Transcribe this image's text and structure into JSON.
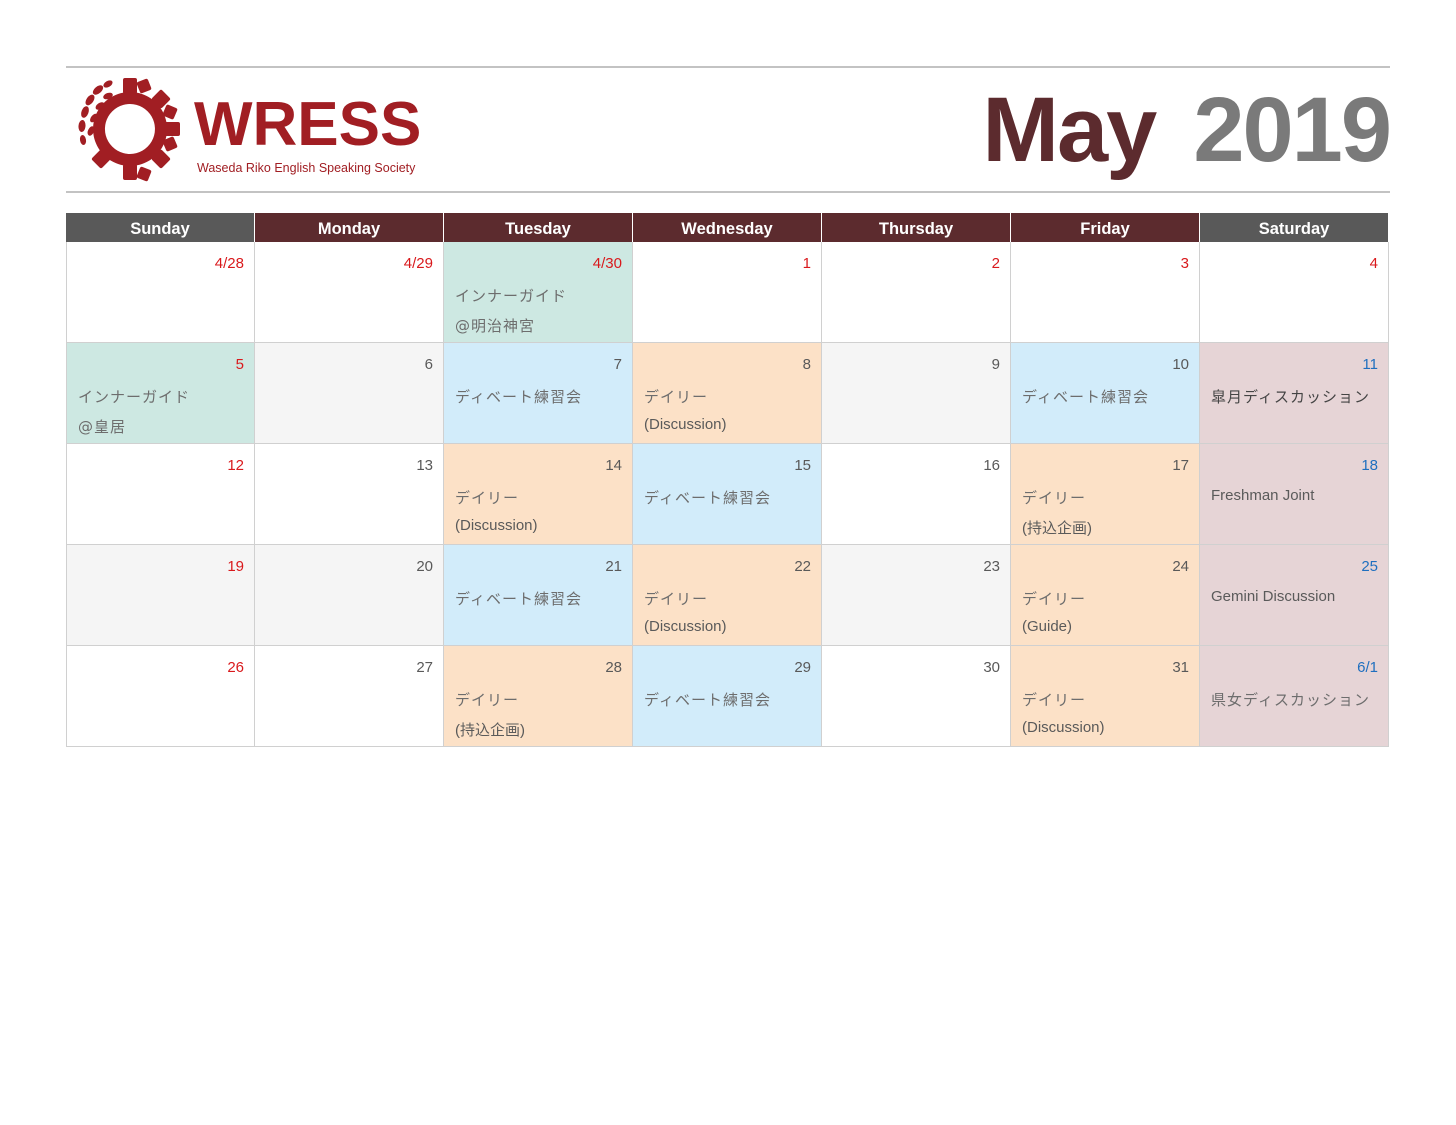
{
  "logo": {
    "name": "WRESS",
    "tagline": "Waseda Riko English Speaking Society",
    "color": "#a11e23"
  },
  "title": {
    "month": "May",
    "year": "2019"
  },
  "colors": {
    "header_weekday": "#5c2b2e",
    "header_weekend": "#595959",
    "holiday_red": "#d9191c",
    "saturday_blue": "#1f6fbf",
    "event_green": "#cde8e2",
    "event_blue": "#d2ecfa",
    "event_orange": "#fce1c7",
    "event_pink": "#e6d4d6"
  },
  "weekdays": [
    "Sunday",
    "Monday",
    "Tuesday",
    "Wednesday",
    "Thursday",
    "Friday",
    "Saturday"
  ],
  "weeks": [
    [
      {
        "date": "4/28",
        "color": "red"
      },
      {
        "date": "4/29",
        "color": "red"
      },
      {
        "date": "4/30",
        "color": "red",
        "bg": "green",
        "lines": [
          "インナーガイド",
          "@明治神宮"
        ]
      },
      {
        "date": "1",
        "color": "red"
      },
      {
        "date": "2",
        "color": "red"
      },
      {
        "date": "3",
        "color": "red"
      },
      {
        "date": "4",
        "color": "red"
      }
    ],
    [
      {
        "date": "5",
        "color": "red",
        "bg": "green",
        "lines": [
          "インナーガイド",
          "@皇居"
        ]
      },
      {
        "date": "6",
        "bg": "shade"
      },
      {
        "date": "7",
        "bg": "blue",
        "lines": [
          "ディベート練習会"
        ]
      },
      {
        "date": "8",
        "bg": "orange",
        "lines": [
          "デイリー",
          "(Discussion)"
        ]
      },
      {
        "date": "9",
        "bg": "shade"
      },
      {
        "date": "10",
        "bg": "blue",
        "lines": [
          "ディベート練習会"
        ]
      },
      {
        "date": "11",
        "color": "blue",
        "bg": "pink",
        "lines": [
          "皐月ディスカッション"
        ],
        "dark": true
      }
    ],
    [
      {
        "date": "12",
        "color": "red"
      },
      {
        "date": "13"
      },
      {
        "date": "14",
        "bg": "orange",
        "lines": [
          "デイリー",
          "(Discussion)"
        ]
      },
      {
        "date": "15",
        "bg": "blue",
        "lines": [
          "ディベート練習会"
        ]
      },
      {
        "date": "16"
      },
      {
        "date": "17",
        "bg": "orange",
        "lines": [
          "デイリー",
          "(持込企画)"
        ]
      },
      {
        "date": "18",
        "color": "blue",
        "bg": "pink",
        "lines": [
          "Freshman Joint"
        ]
      }
    ],
    [
      {
        "date": "19",
        "color": "red",
        "bg": "shade"
      },
      {
        "date": "20",
        "bg": "shade"
      },
      {
        "date": "21",
        "bg": "blue",
        "lines": [
          "ディベート練習会"
        ]
      },
      {
        "date": "22",
        "bg": "orange",
        "lines": [
          "デイリー",
          "(Discussion)"
        ]
      },
      {
        "date": "23",
        "bg": "shade"
      },
      {
        "date": "24",
        "bg": "orange",
        "lines": [
          "デイリー",
          "(Guide)"
        ]
      },
      {
        "date": "25",
        "color": "blue",
        "bg": "pink",
        "lines": [
          "Gemini Discussion"
        ]
      }
    ],
    [
      {
        "date": "26",
        "color": "red"
      },
      {
        "date": "27"
      },
      {
        "date": "28",
        "bg": "orange",
        "lines": [
          "デイリー",
          "(持込企画)"
        ]
      },
      {
        "date": "29",
        "bg": "blue",
        "lines": [
          "ディベート練習会"
        ]
      },
      {
        "date": "30"
      },
      {
        "date": "31",
        "bg": "orange",
        "lines": [
          "デイリー",
          "(Discussion)"
        ]
      },
      {
        "date": "6/1",
        "color": "blue",
        "bg": "pink",
        "lines": [
          "県女ディスカッション"
        ]
      }
    ]
  ]
}
